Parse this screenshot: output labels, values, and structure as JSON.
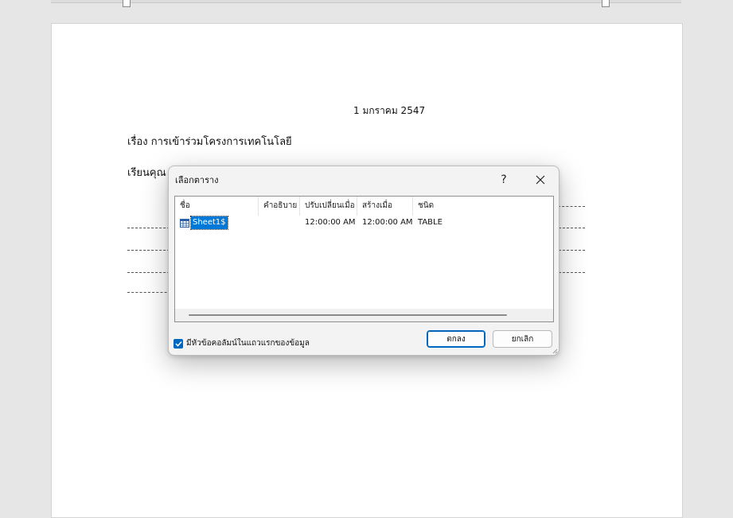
{
  "document": {
    "date": "1 มกราคม 2547",
    "subject": "เรื่อง การเข้าร่วมโครงการเทคโนโลยี",
    "salutation": "เรียนคุณ"
  },
  "dialog": {
    "title": "เลือกตาราง",
    "help_glyph": "?",
    "columns": [
      "ชื่อ",
      "คำอธิบาย",
      "ปรับเปลี่ยนเมื่อ",
      "สร้างเมื่อ",
      "ชนิด"
    ],
    "rows": [
      {
        "name": "Sheet1$",
        "description": "",
        "modified": "12:00:00 AM",
        "created": "12:00:00 AM",
        "type": "TABLE",
        "icon": "table-icon",
        "selected": true
      }
    ],
    "checkbox": {
      "label": "มีหัวข้อคอลัมน์ในแถวแรกของข้อมูล",
      "checked": true
    },
    "ok_label": "ตกลง",
    "cancel_label": "ยกเลิก"
  },
  "colors": {
    "accent": "#0067c0",
    "selection": "#0078d7"
  }
}
